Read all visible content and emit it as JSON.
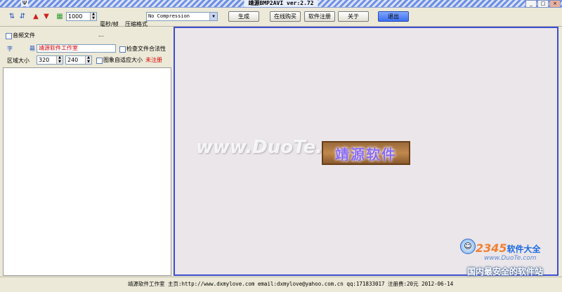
{
  "window": {
    "title": "靖源BMP2AVI ver:2.72",
    "app_icon": "Ψ"
  },
  "toolbar": {
    "icons": [
      "sort-asc-icon",
      "sort-desc-icon",
      "arrow-up-icon",
      "arrow-down-icon",
      "grid-icon"
    ],
    "interval_value": "1000",
    "interval_unit": "毫秒/帧",
    "compress_label": "压缩格式",
    "compress_value": "No Compression",
    "buttons": {
      "generate": "生成",
      "buy": "在线购买",
      "register": "软件注册",
      "about": "关于",
      "exit": "退出"
    }
  },
  "left": {
    "audio_label": "音频文件",
    "audio_more": "...",
    "subtitle_char1": "字",
    "subtitle_char2": "幕",
    "subtitle_value": "靖源软件工作室",
    "check_legal_label": "检查文件合法性",
    "area_label": "区域大小",
    "width_value": "320",
    "height_value": "240",
    "autosize_label": "图象自适应大小",
    "unregistered": "未注册"
  },
  "canvas": {
    "logo_text": "靖源软件",
    "watermark": "www.DuoTe.com"
  },
  "status": {
    "text": "靖源软件工作室  主页:http://www.dxmylove.com email:dxmylove@yahoo.com.cn qq:171833017  注册费:20元 2012-06-14"
  },
  "corner": {
    "brand": "2345",
    "brand_suffix": "软件大全",
    "url": "www.DuoTe.com",
    "slogan": "国内最安全的软件站"
  }
}
